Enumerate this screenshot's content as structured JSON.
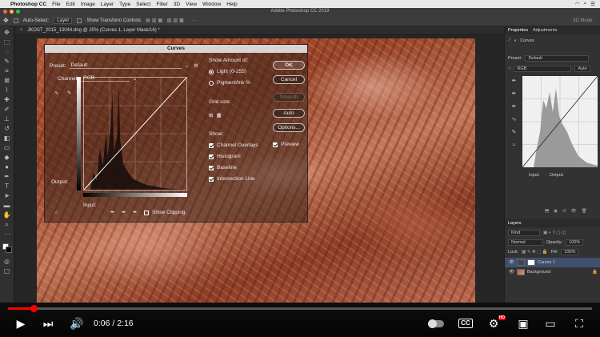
{
  "menubar": {
    "app_name": "Photoshop CC",
    "items": [
      "File",
      "Edit",
      "Image",
      "Layer",
      "Type",
      "Select",
      "Filter",
      "3D",
      "View",
      "Window",
      "Help"
    ]
  },
  "window": {
    "title": "Adobe Photoshop CC 2019"
  },
  "options_bar": {
    "auto_select_label": "Auto-Select:",
    "auto_select_value": "Layer",
    "show_transform_label": "Show Transform Controls",
    "mode_label": "3D Mode:"
  },
  "document": {
    "tab_title": "JKOST_2015_13044.dng @ 25% (Curves 1, Layer Mask/16) *"
  },
  "curves_dialog": {
    "title": "Curves",
    "preset_label": "Preset:",
    "preset_value": "Default",
    "channel_label": "Channel:",
    "channel_value": "RGB",
    "output_label": "Output:",
    "input_label": "Input:",
    "show_clipping_label": "Show Clipping",
    "show_amount_label": "Show Amount of:",
    "light_label": "Light  (0-255)",
    "pigment_label": "Pigment/Ink %",
    "grid_size_label": "Grid size:",
    "show_label": "Show:",
    "channel_overlays_label": "Channel Overlays",
    "histogram_label": "Histogram",
    "baseline_label": "Baseline",
    "intersection_label": "Intersection Line",
    "ok_label": "OK",
    "cancel_label": "Cancel",
    "smooth_label": "Smooth",
    "auto_label": "Auto",
    "options_label": "Options...",
    "preview_label": "Preview"
  },
  "properties_panel": {
    "tab_properties": "Properties",
    "tab_adjustments": "Adjustments",
    "adjustment_name": "Curves",
    "preset_label": "Preset:",
    "preset_value": "Default",
    "channel_value": "RGB",
    "auto_label": "Auto",
    "input_label": "Input:",
    "output_label": "Output:"
  },
  "layers_panel": {
    "tab_layers": "Layers",
    "kind_label": "Kind",
    "blend_mode": "Normal",
    "opacity_label": "Opacity:",
    "opacity_value": "100%",
    "lock_label": "Lock:",
    "fill_label": "Fill:",
    "fill_value": "100%",
    "layers": [
      {
        "name": "Curves 1",
        "selected": true
      },
      {
        "name": "Background",
        "selected": false
      }
    ]
  },
  "video_player": {
    "time_display": "0:06 / 2:16",
    "progress": 0.044,
    "settings_badge": "HD",
    "accent_color": "#ff0000"
  }
}
